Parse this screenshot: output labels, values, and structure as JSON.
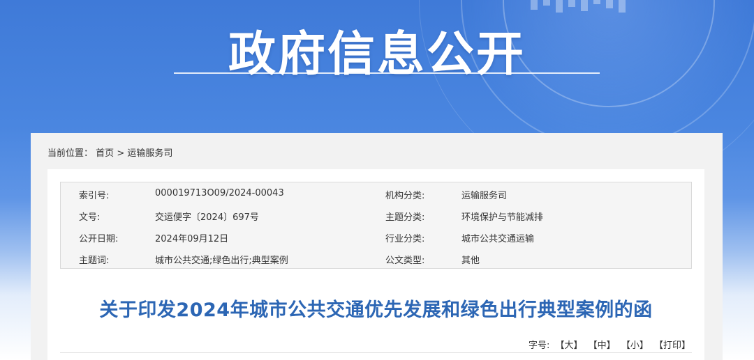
{
  "banner": {
    "title": "政府信息公开"
  },
  "breadcrumb": {
    "prefix": "当前位置：",
    "home": "首页",
    "separator": ">",
    "current": "运输服务司"
  },
  "meta": {
    "rows": [
      {
        "k1": "索引号:",
        "v1": "000019713O09/2024-00043",
        "k2": "机构分类:",
        "v2": "运输服务司"
      },
      {
        "k1": "文号:",
        "v1": "交运便字〔2024〕697号",
        "k2": "主题分类:",
        "v2": "环境保护与节能减排"
      },
      {
        "k1": "公开日期:",
        "v1": "2024年09月12日",
        "k2": "行业分类:",
        "v2": "城市公共交通运输"
      },
      {
        "k1": "主题词:",
        "v1": "城市公共交通;绿色出行;典型案例",
        "k2": "公文类型:",
        "v2": "其他"
      }
    ]
  },
  "document": {
    "title": "关于印发2024年城市公共交通优先发展和绿色出行典型案例的函"
  },
  "font_tools": {
    "label": "字号:",
    "large": "【大】",
    "medium": "【中】",
    "small": "【小】",
    "print": "【打印】"
  }
}
